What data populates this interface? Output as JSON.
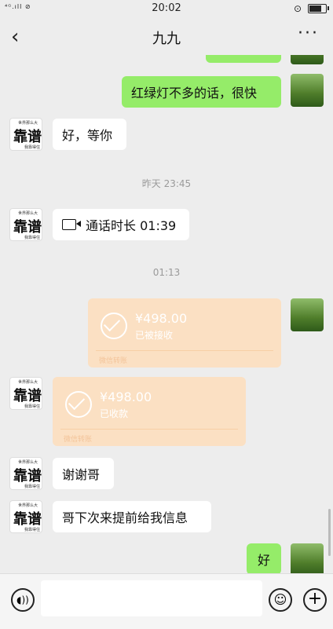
{
  "status_bar": {
    "signal": "⁴ᴳ.ıll  ⊘",
    "time": "20:02"
  },
  "header": {
    "back_icon": "‹",
    "title": "九九",
    "more_icon": "···"
  },
  "messages": [
    {
      "type": "text",
      "from": "me",
      "text": "红绿灯不多的话，很快"
    },
    {
      "type": "text",
      "from": "other",
      "text": "好，等你"
    },
    {
      "type": "time",
      "text": "昨天 23:45"
    },
    {
      "type": "call",
      "from": "other",
      "text": "通话时长 01:39"
    },
    {
      "type": "time",
      "text": "01:13"
    },
    {
      "type": "transfer",
      "from": "me",
      "amount": "¥498.00",
      "status": "已被接收",
      "footer": "微信转账"
    },
    {
      "type": "transfer",
      "from": "other",
      "amount": "¥498.00",
      "status": "已收款",
      "footer": "微信转账"
    },
    {
      "type": "text",
      "from": "other",
      "text": "谢谢哥"
    },
    {
      "type": "text",
      "from": "other",
      "text": "哥下次来提前给我信息"
    },
    {
      "type": "text",
      "from": "me",
      "text": "好"
    }
  ],
  "avatar_text": {
    "main": "靠谱",
    "top": "世界那么大",
    "bottom": "我靠得住"
  },
  "input_bar": {
    "voice_icon": "voice-icon",
    "emoji_icon": "☺",
    "plus_icon": "+"
  },
  "colors": {
    "green_bubble": "#95ec69",
    "transfer": "#fbe0c3",
    "background": "#ededed"
  }
}
